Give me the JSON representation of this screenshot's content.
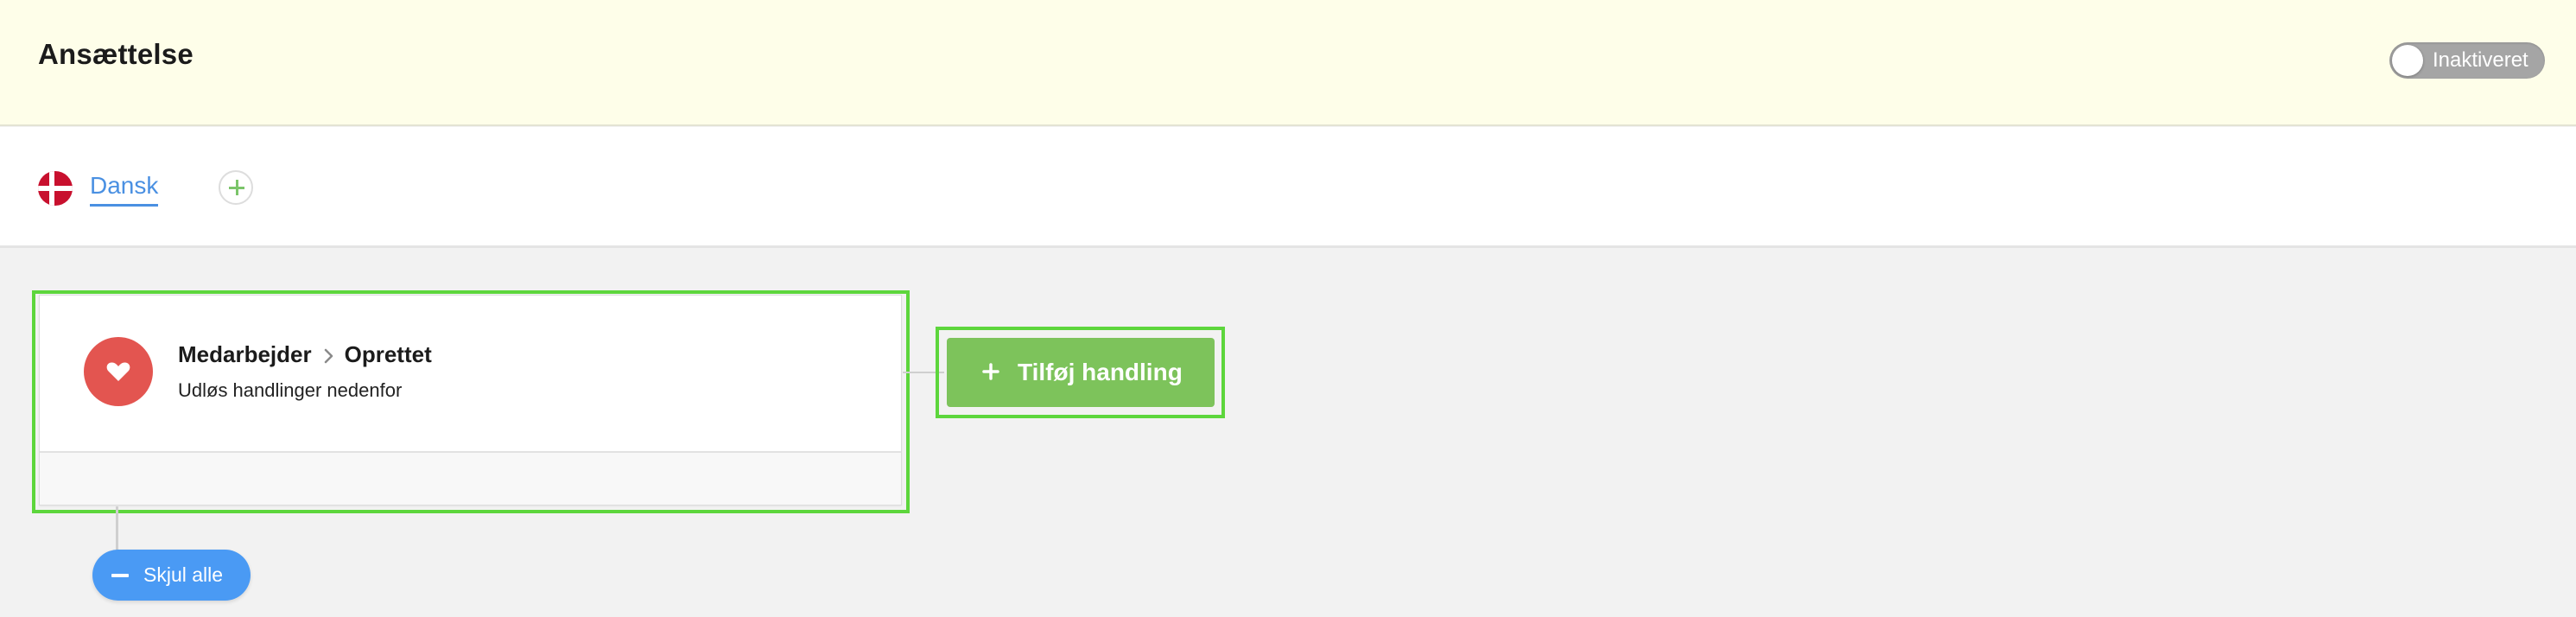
{
  "header": {
    "title": "Ansættelse",
    "toggle_label": "Inaktiveret",
    "toggle_state": "off"
  },
  "language_bar": {
    "active_language": "Dansk",
    "flag_icon": "denmark-flag-icon",
    "add_icon": "plus-circle-icon"
  },
  "trigger": {
    "icon": "heart-icon",
    "entity": "Medarbejder",
    "separator_icon": "chevron-right-icon",
    "event": "Oprettet",
    "subtitle": "Udløs handlinger nedenfor"
  },
  "actions": {
    "add_action_label": "Tilføj handling",
    "add_action_icon": "plus-icon",
    "collapse_all_label": "Skjul alle",
    "collapse_icon": "minus-icon"
  },
  "colors": {
    "header_bg": "#fefee9",
    "link_blue": "#4a90e2",
    "trigger_red": "#e35550",
    "action_green": "#7dc35b",
    "collapse_blue": "#4a9af4",
    "highlight_green": "#5dd63c"
  }
}
